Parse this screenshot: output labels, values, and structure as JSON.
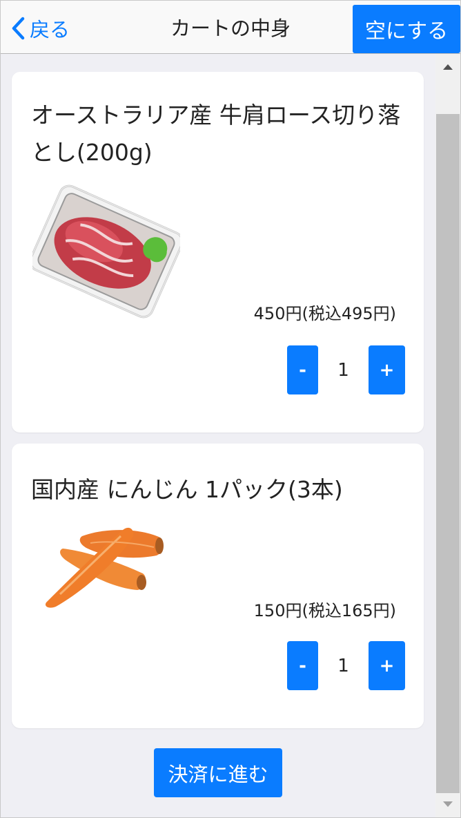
{
  "header": {
    "back_label": "戻る",
    "title": "カートの中身",
    "empty_label": "空にする"
  },
  "items": [
    {
      "name": "オーストラリア産 牛肩ロース切り落とし(200g)",
      "price": "450円(税込495円)",
      "quantity": "1",
      "image_icon": "beef-pack-image"
    },
    {
      "name": "国内産 にんじん 1パック(3本)",
      "price": "150円(税込165円)",
      "quantity": "1",
      "image_icon": "carrots-image"
    }
  ],
  "controls": {
    "minus_label": "-",
    "plus_label": "+",
    "checkout_label": "決済に進む"
  },
  "colors": {
    "accent": "#0a7cff",
    "background": "#efeff4",
    "card": "#ffffff"
  }
}
